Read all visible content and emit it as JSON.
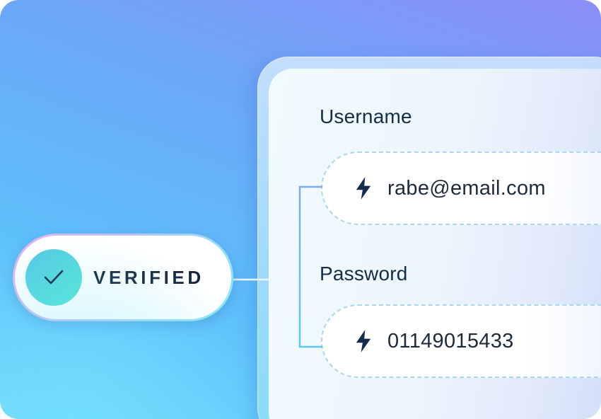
{
  "badge": {
    "status": "VERIFIED",
    "icon": "checkmark-icon"
  },
  "form": {
    "username": {
      "label": "Username",
      "value": "rabe@email.com",
      "icon": "lightning-bolt-icon"
    },
    "password": {
      "label": "Password",
      "value": "01149015433",
      "icon": "lightning-bolt-icon"
    }
  },
  "colors": {
    "accent_teal": "#4ee6cf",
    "label_text": "#132d4b",
    "dashed_border": "#a9d7ee",
    "connector": "#6fb4f4"
  }
}
